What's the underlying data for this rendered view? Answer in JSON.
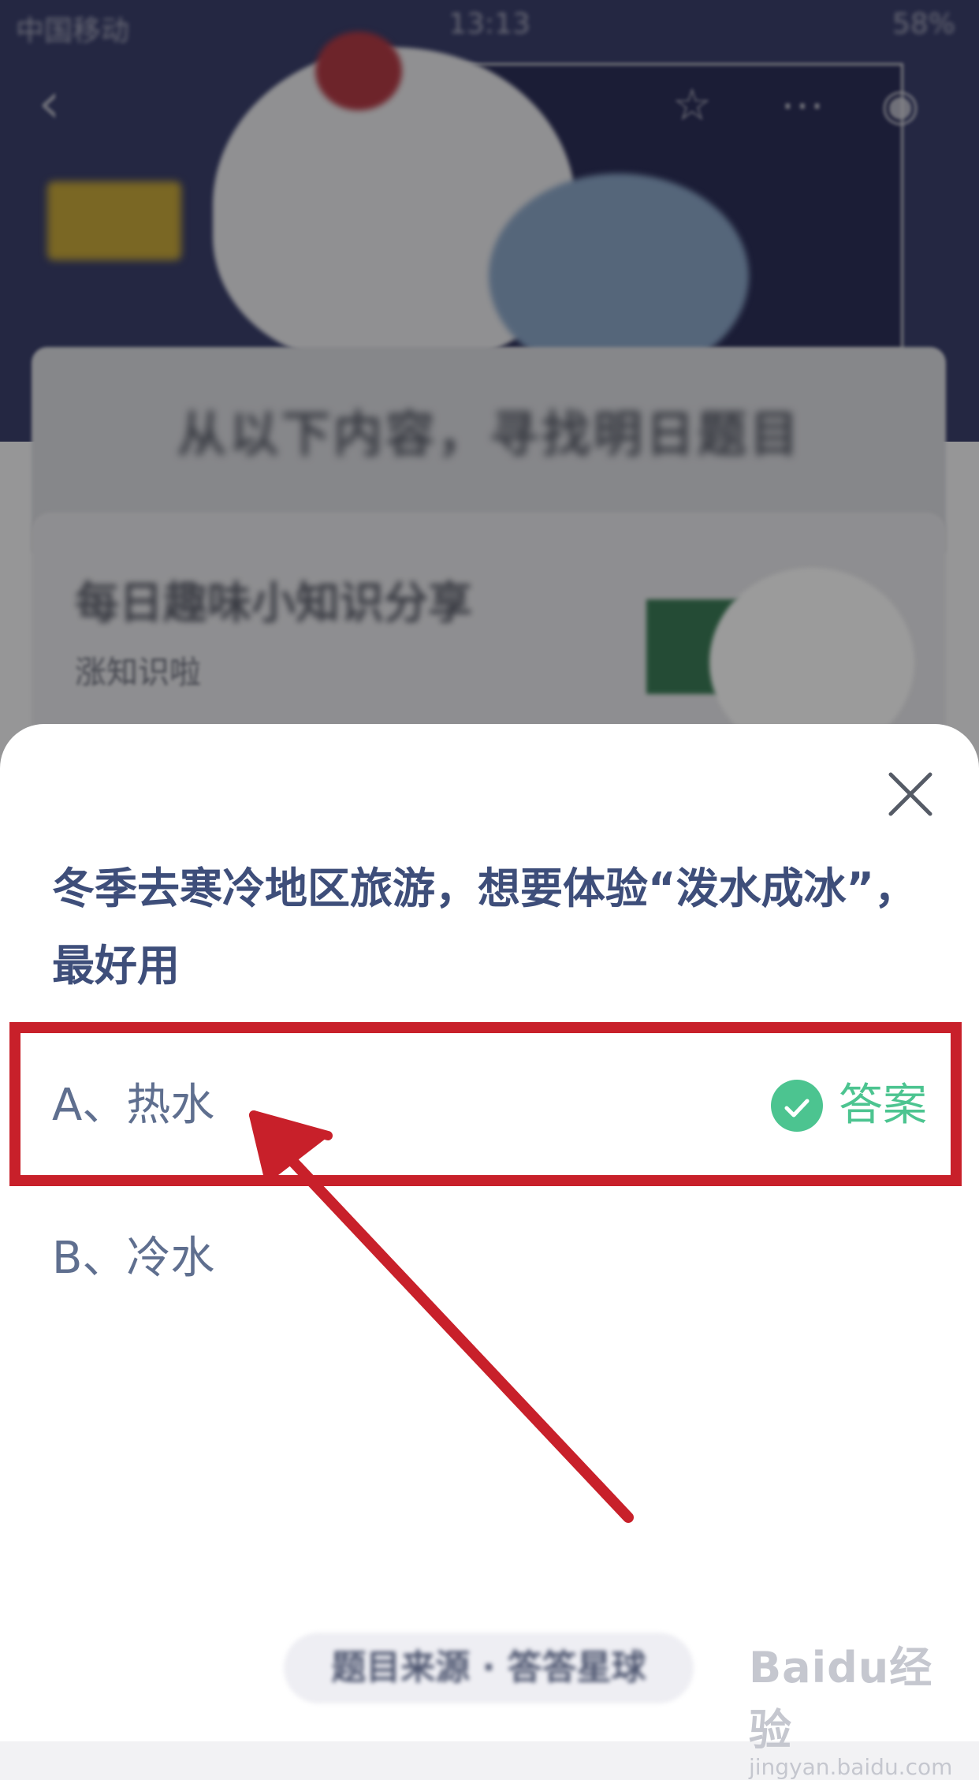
{
  "status_bar": {
    "carrier": "中国移动",
    "time": "13:13",
    "battery": "58%"
  },
  "background": {
    "heading": "从以下内容，寻找明日题目",
    "card_title": "每日趣味小知识分享",
    "card_subtitle": "涨知识啦"
  },
  "quiz": {
    "question": "冬季去寒冷地区旅游，想要体验“泼水成冰”，最好用",
    "options": [
      {
        "label": "A、热水",
        "is_answer": true,
        "badge": "答案"
      },
      {
        "label": "B、冷水",
        "is_answer": false
      }
    ],
    "bottom_button": "题目来源 · 答答星球"
  },
  "annotation": {
    "highlight_color": "#c8202a"
  },
  "watermark": {
    "brand": "Baidu经验",
    "url": "jingyan.baidu.com"
  },
  "colors": {
    "question_text": "#3e4e7a",
    "option_text": "#5f6f8f",
    "answer_green": "#4cc490"
  }
}
